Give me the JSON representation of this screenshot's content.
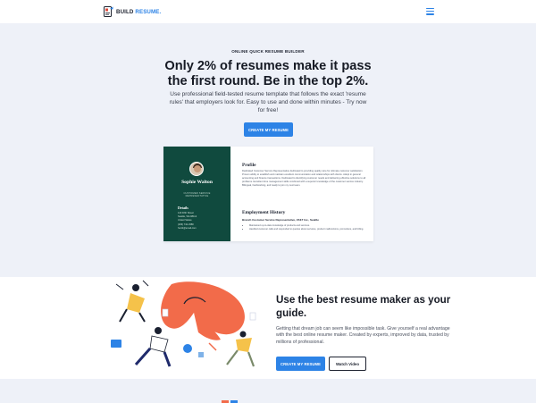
{
  "header": {
    "brand_part1": "BUILD",
    "brand_part2": "RESUME."
  },
  "hero": {
    "eyebrow": "ONLINE QUICK RESUME BUILDER",
    "title": "Only 2% of resumes make it pass the first round. Be in the top 2%.",
    "description": "Use professional field-tested resume template that follows the exact 'resume rules' that employers look for. Easy to use and done within minutes - Try now for free!",
    "cta_label": "CREATE MY RESUME"
  },
  "resume": {
    "name": "Sophie Walton",
    "role": "CUSTOMER SERVICE REPRESENTATIVE",
    "details_heading": "Details",
    "details": [
      "123 Fifth Street",
      "Seattle, WA 98112",
      "United States",
      "(206) 742-3380",
      "hw12@email.com"
    ],
    "profile_heading": "Profile",
    "profile_text": "Dedicated Customer Service Representative dedicated to providing quality care for ultimate customer satisfaction. Proven ability to establish and maintain excellent communication and relationships with clients. Adept in general accounting and finance transactions. Dedicated to identifying customer needs and delivering effective solutions to all problems. Excellent time management skills combined with a superior knowledge of the customer service industry. Bilingual, hardworking, and ready to join my next team.",
    "employment_heading": "Employment History",
    "job_title": "Branch Customer Service Representative, AT&T Inc., Seattle",
    "bullets": [
      "Maintained up-to-date knowledge of products and services.",
      "Handled customer calls and responded to queries about services, product malfunctions, promotions, and billing."
    ]
  },
  "section2": {
    "title": "Use the best resume maker as your guide.",
    "description": "Getting that dream job can seem like impossible task. Give yourself a real advantage with the best online resume maker. Created by experts, improved by data, trusted by millions of professional.",
    "primary_label": "CREATE MY RESUME",
    "secondary_label": "Watch Video"
  },
  "colors": {
    "accent": "#2d83e6",
    "hero_bg": "#eef1f8",
    "resume_sidebar": "#104a3e",
    "illustration_orange": "#f26b4a"
  },
  "icons": {
    "logo": "resume-doc-logo",
    "menu": "hamburger-menu-icon"
  }
}
